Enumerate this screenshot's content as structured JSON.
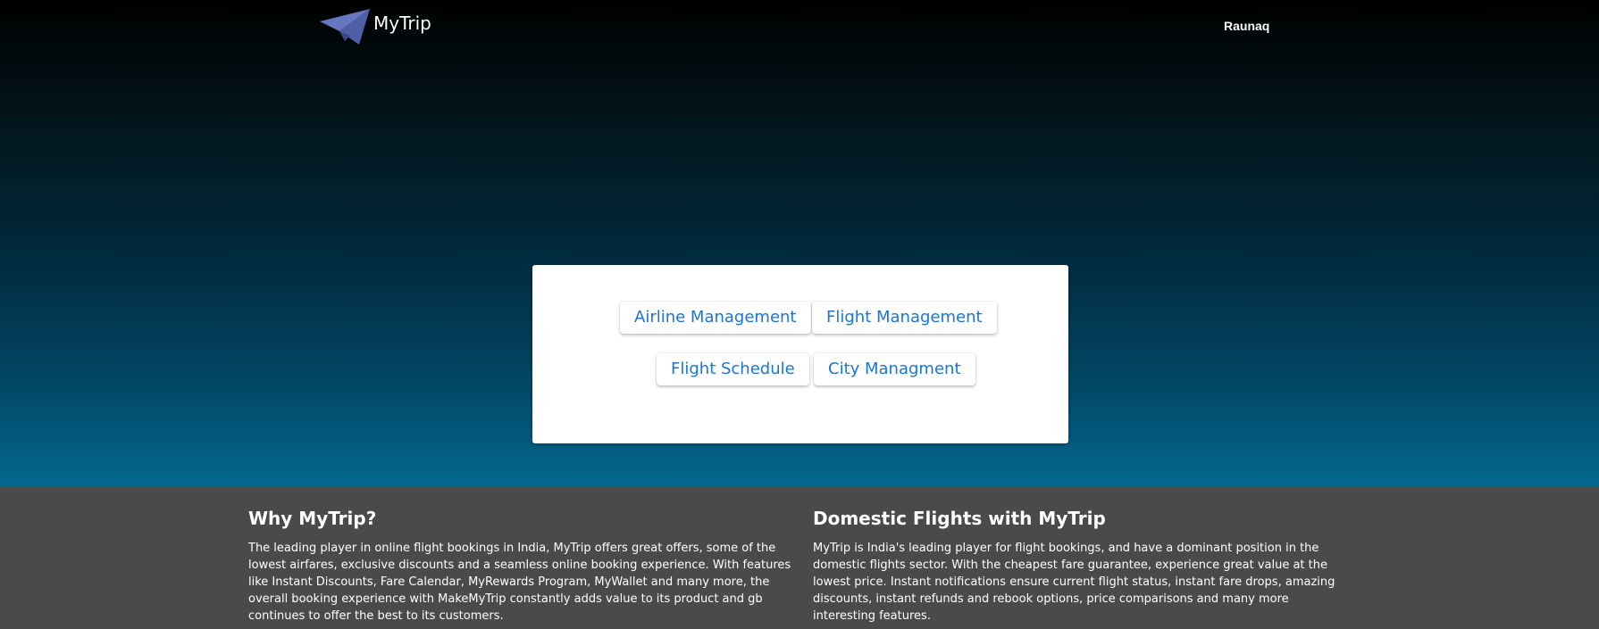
{
  "header": {
    "brand_name": "MyTrip",
    "user_name": "Raunaq",
    "logo_icon": "paper-plane-icon"
  },
  "menu": {
    "airline_management": "Airline Management",
    "flight_management": "Flight Management",
    "flight_schedule": "Flight Schedule",
    "city_management": "City Managment"
  },
  "footer": {
    "why": {
      "title": "Why MyTrip?",
      "text": "The leading player in online flight bookings in India, MyTrip offers great offers, some of the lowest airfares, exclusive discounts and a seamless online booking experience. With features like Instant Discounts, Fare Calendar, MyRewards Program, MyWallet and many more, the overall booking experience with MakeMyTrip constantly adds value to its product and gb continues to offer the best to its customers."
    },
    "domestic": {
      "title": "Domestic Flights with MyTrip",
      "text": "MyTrip is India's leading player for flight bookings, and have a dominant position in the domestic flights sector. With the cheapest fare guarantee, experience great value at the lowest price. Instant notifications ensure current flight status, instant fare drops, amazing discounts, instant refunds and rebook options, price comparisons and many more interesting features."
    }
  },
  "colors": {
    "button_text": "#1976d2",
    "footer_bg": "#4a4a4a",
    "logo": "#5f6fb3"
  }
}
